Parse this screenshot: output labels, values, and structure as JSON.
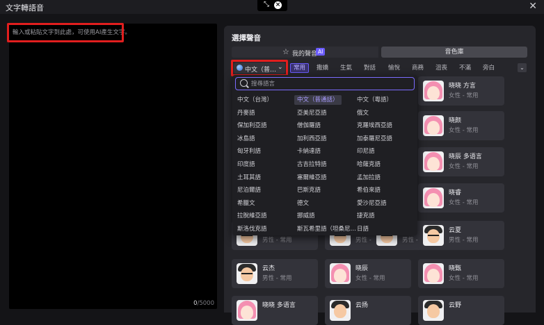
{
  "window": {
    "title": "文字轉語音"
  },
  "editor": {
    "placeholder": "輸入或粘貼文字到此處，可使用AI產生文字。",
    "count": "0",
    "max": "/5000"
  },
  "panel": {
    "title": "選擇聲音",
    "tab_mine": "我的聲音",
    "tab_mine_badge": "AI",
    "tab_library": "音色庫",
    "lang_select": "中文（普…",
    "chips": [
      "常用",
      "撒嬌",
      "生氣",
      "對話",
      "愉悅",
      "商務",
      "沮喪",
      "不滿",
      "旁白"
    ]
  },
  "dropdown": {
    "search_placeholder": "搜尋語言",
    "languages": [
      [
        "中文（台灣）",
        "中文（普通話）",
        "中文（粵語）"
      ],
      [
        "丹麥語",
        "亞美尼亞語",
        "俄文"
      ],
      [
        "保加利亞語",
        "僧伽羅語",
        "克羅埃西亞語"
      ],
      [
        "冰島語",
        "加利西亞語",
        "加泰羅尼亞語"
      ],
      [
        "匈牙利語",
        "卡納達語",
        "印尼語"
      ],
      [
        "印度語",
        "古吉拉特語",
        "哈薩克語"
      ],
      [
        "土耳其語",
        "塞爾維亞語",
        "孟加拉語"
      ],
      [
        "尼泊爾語",
        "巴斯克語",
        "希伯來語"
      ],
      [
        "希臘文",
        "德文",
        "愛沙尼亞語"
      ],
      [
        "拉脫維亞語",
        "挪威語",
        "捷克語"
      ],
      [
        "斯洛伐克語",
        "斯瓦希里語（坦桑尼…",
        "日語"
      ]
    ]
  },
  "cards": [
    {
      "name": "晓晓 方言",
      "sub": "女性 - 常用",
      "gender": "f"
    },
    {
      "name": "晓颜",
      "sub": "女性 - 常用",
      "gender": "f"
    },
    {
      "name": "晓辰 多语言",
      "sub": "女性 - 常用",
      "gender": "f"
    },
    {
      "name": "晓睿",
      "sub": "女性 - 常用",
      "gender": "f"
    },
    {
      "name": "",
      "sub": "男性 - 常用",
      "gender": "m"
    },
    {
      "name": "",
      "sub": "男性 - 常用",
      "gender": "m"
    },
    {
      "name": "",
      "sub": "男性 - 常用",
      "gender": "m"
    },
    {
      "name": "云夏",
      "sub": "男性 - 常用",
      "gender": "m"
    },
    {
      "name": "云杰",
      "sub": "男性 - 常用",
      "gender": "m"
    },
    {
      "name": "晓辰",
      "sub": "女性 - 常用",
      "gender": "f"
    },
    {
      "name": "晓甄",
      "sub": "女性 - 常用",
      "gender": "f"
    },
    {
      "name": "晓晓 多语言",
      "sub": "",
      "gender": "f"
    },
    {
      "name": "云扬",
      "sub": "",
      "gender": "m"
    },
    {
      "name": "云野",
      "sub": "",
      "gender": "m"
    }
  ]
}
